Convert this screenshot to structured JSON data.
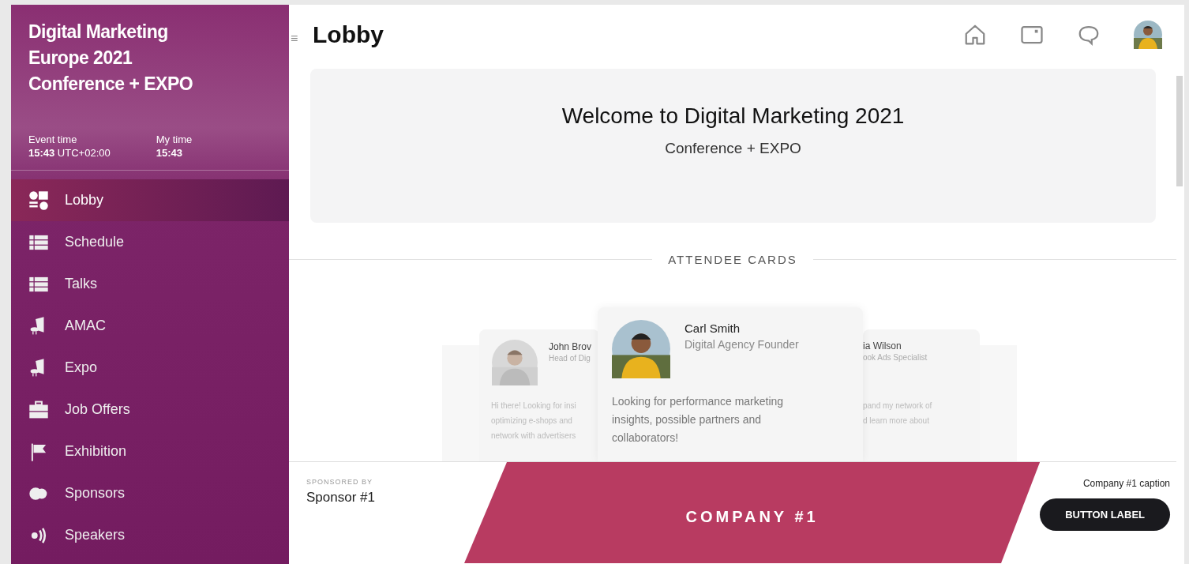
{
  "event": {
    "title": "Digital Marketing Europe 2021 Conference + EXPO",
    "event_time_label": "Event time",
    "event_time": "15:43",
    "event_zone": "UTC+02:00",
    "my_time_label": "My time",
    "my_time": "15:43"
  },
  "nav": [
    {
      "label": "Lobby",
      "kind": "lobby",
      "selected": true
    },
    {
      "label": "Schedule",
      "kind": "list",
      "selected": false
    },
    {
      "label": "Talks",
      "kind": "list",
      "selected": false
    },
    {
      "label": "AMAC",
      "kind": "stand",
      "selected": false
    },
    {
      "label": "Expo",
      "kind": "stand",
      "selected": false
    },
    {
      "label": "Job Offers",
      "kind": "briefcase",
      "selected": false
    },
    {
      "label": "Exhibition",
      "kind": "flag",
      "selected": false
    },
    {
      "label": "Sponsors",
      "kind": "coins",
      "selected": false
    },
    {
      "label": "Speakers",
      "kind": "speaker",
      "selected": false
    }
  ],
  "header": {
    "menu_glyph": "≡",
    "title": "Lobby"
  },
  "welcome": {
    "title": "Welcome to Digital Marketing 2021",
    "subtitle": "Conference + EXPO"
  },
  "attendees": {
    "heading": "ATTENDEE CARDS",
    "cards": [
      {
        "kind": "left",
        "name": "John Brov",
        "role": "Head of Dig",
        "bio_lines": [
          "Hi there! Looking for insi",
          "optimizing e-shops and",
          "network with advertisers"
        ]
      },
      {
        "kind": "center",
        "name": "Carl Smith",
        "role": "Digital Agency Founder",
        "bio_lines": [
          "Looking for performance marketing insights, possible partners and collaborators!"
        ]
      },
      {
        "kind": "right",
        "name": "ia Wilson",
        "role": "ook Ads Specialist",
        "bio_lines": [
          "pand my network of",
          "d learn more about"
        ]
      }
    ]
  },
  "sponsor": {
    "label": "SPONSORED BY",
    "name": "Sponsor #1",
    "banner": "COMPANY #1",
    "caption": "Company #1 caption",
    "button": "BUTTON LABEL"
  }
}
